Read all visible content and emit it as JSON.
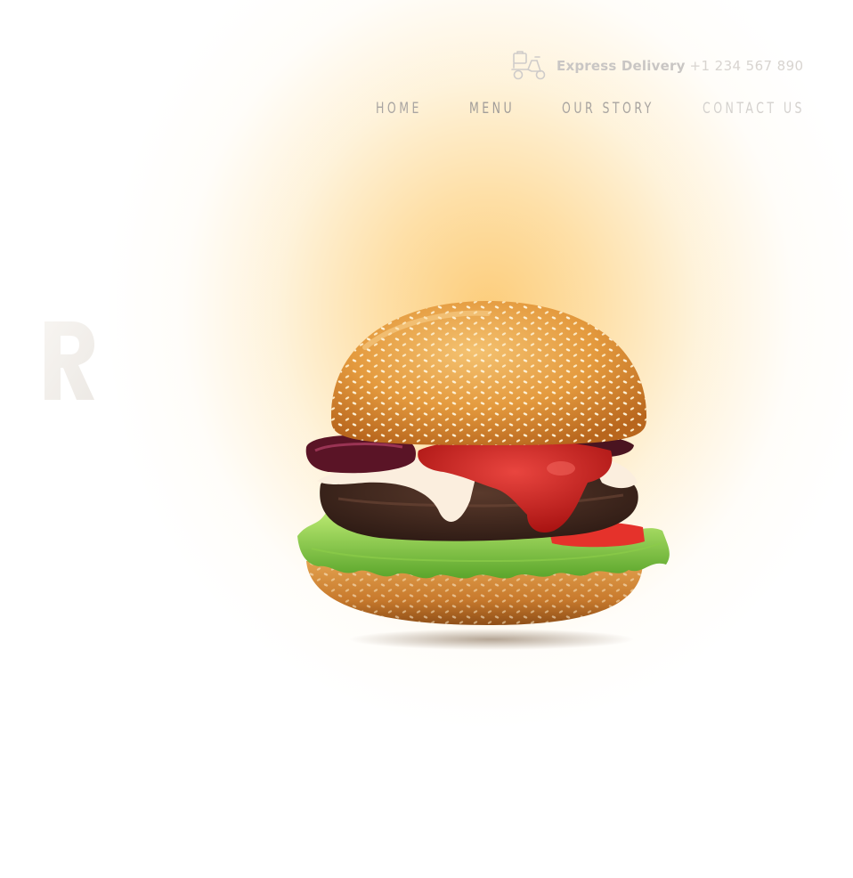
{
  "header": {
    "delivery_icon": "delivery-scooter-icon",
    "delivery_label": "Express Delivery",
    "delivery_phone": "+1 234 567 890"
  },
  "nav": {
    "items": [
      {
        "label": "HOME"
      },
      {
        "label": "MENU"
      },
      {
        "label": "OUR STORY"
      },
      {
        "label": "CONTACT US"
      }
    ]
  },
  "hero": {
    "image": "burger-image",
    "logo_fragment_icon": "logo-letter-icon"
  },
  "colors": {
    "glow": "#fcc464",
    "nav_text": "#9a9692",
    "delivery_text": "#c9c6c4"
  }
}
